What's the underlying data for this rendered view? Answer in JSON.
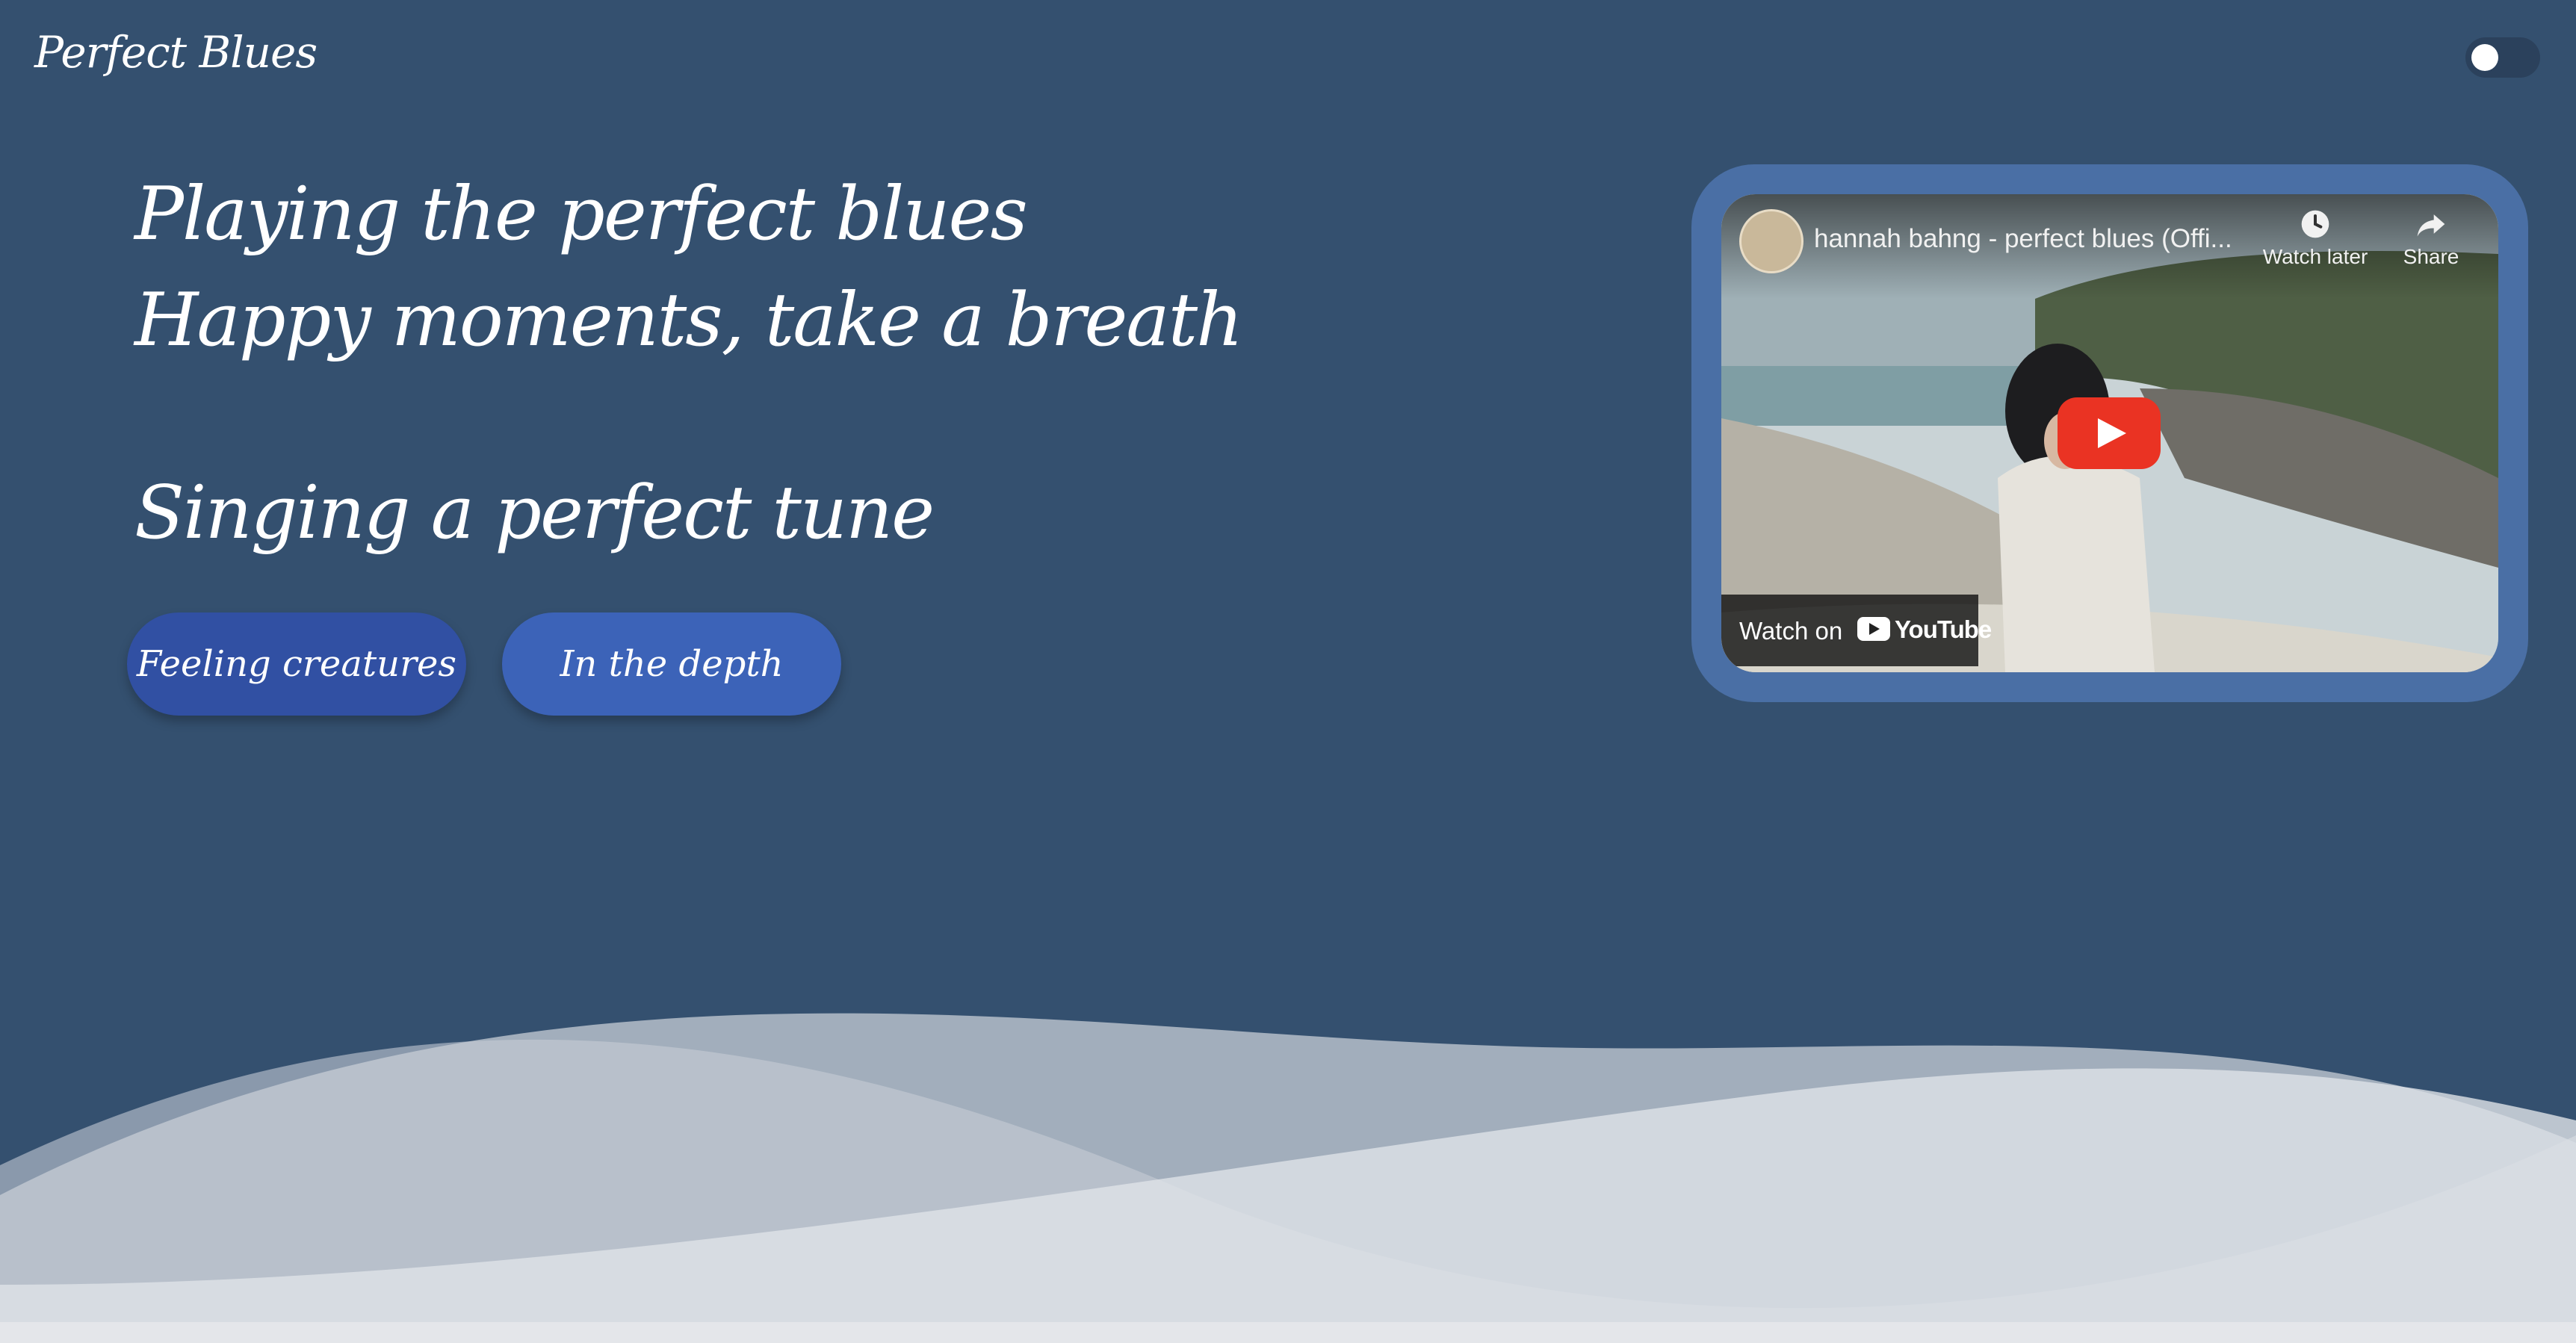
{
  "header": {
    "brand": "Perfect Blues",
    "theme_toggle_state": "off"
  },
  "hero": {
    "line1": "Playing the perfect blues",
    "line2": "Happy moments, take a breath",
    "line3": "Singing a perfect tune"
  },
  "buttons": {
    "primary_label": "Feeling creatures",
    "secondary_label": "In the depth"
  },
  "video": {
    "title": "hannah bahng - perfect blues (Offi...",
    "watch_later_label": "Watch later",
    "share_label": "Share",
    "watch_on_label": "Watch on",
    "youtube_label": "YouTube",
    "icons": [
      "channel-avatar",
      "clock-icon",
      "share-arrow-icon",
      "play-icon",
      "youtube-logo-icon"
    ]
  },
  "colors": {
    "background": "#34506f",
    "button_primary": "#3150a3",
    "button_secondary": "#3c63b8",
    "video_frame": "#4a6fa5",
    "youtube_red": "#ea3323",
    "wave_light": "#e4e6ea"
  }
}
